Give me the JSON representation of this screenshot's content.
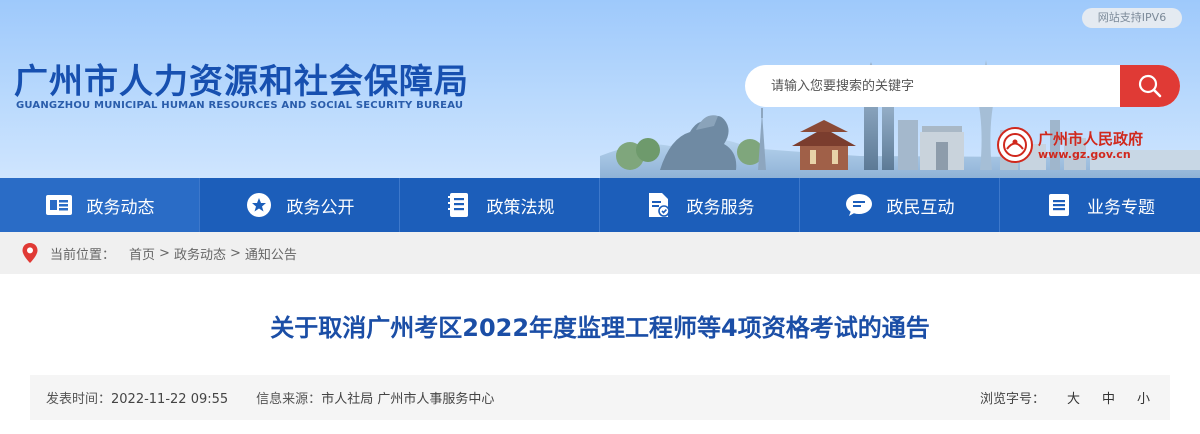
{
  "header": {
    "ipv6_badge": "网站支持IPV6",
    "site_title": "广州市人力资源和社会保障局",
    "site_subtitle": "GUANGZHOU MUNICIPAL HUMAN RESOURCES AND SOCIAL SECURITY BUREAU",
    "search": {
      "placeholder": "请输入您要搜索的关键字",
      "value": ""
    },
    "gov_logo": {
      "name": "广州市人民政府",
      "url": "www.gz.gov.cn"
    }
  },
  "nav": {
    "items": [
      {
        "label": "政务动态",
        "icon": "news-icon",
        "active": true
      },
      {
        "label": "政务公开",
        "icon": "star-icon",
        "active": false
      },
      {
        "label": "政策法规",
        "icon": "document-icon",
        "active": false
      },
      {
        "label": "政务服务",
        "icon": "service-doc-icon",
        "active": false
      },
      {
        "label": "政民互动",
        "icon": "chat-icon",
        "active": false
      },
      {
        "label": "业务专题",
        "icon": "list-icon",
        "active": false
      }
    ]
  },
  "breadcrumb": {
    "prefix": "当前位置：",
    "items": [
      "首页",
      "政务动态",
      "通知公告"
    ],
    "separator": ">"
  },
  "article": {
    "title": "关于取消广州考区2022年度监理工程师等4项资格考试的通告",
    "meta": {
      "publish_label": "发表时间：",
      "publish_time": "2022-11-22 09:55",
      "source_label": "信息来源：",
      "source": "市人社局 广州市人事服务中心",
      "font_size_label": "浏览字号：",
      "font_sizes": [
        "大",
        "中",
        "小"
      ]
    }
  },
  "colors": {
    "primary_blue": "#1c5eba",
    "title_blue": "#1b4ea6",
    "search_red": "#e03a35",
    "gov_red": "#d0281d"
  }
}
